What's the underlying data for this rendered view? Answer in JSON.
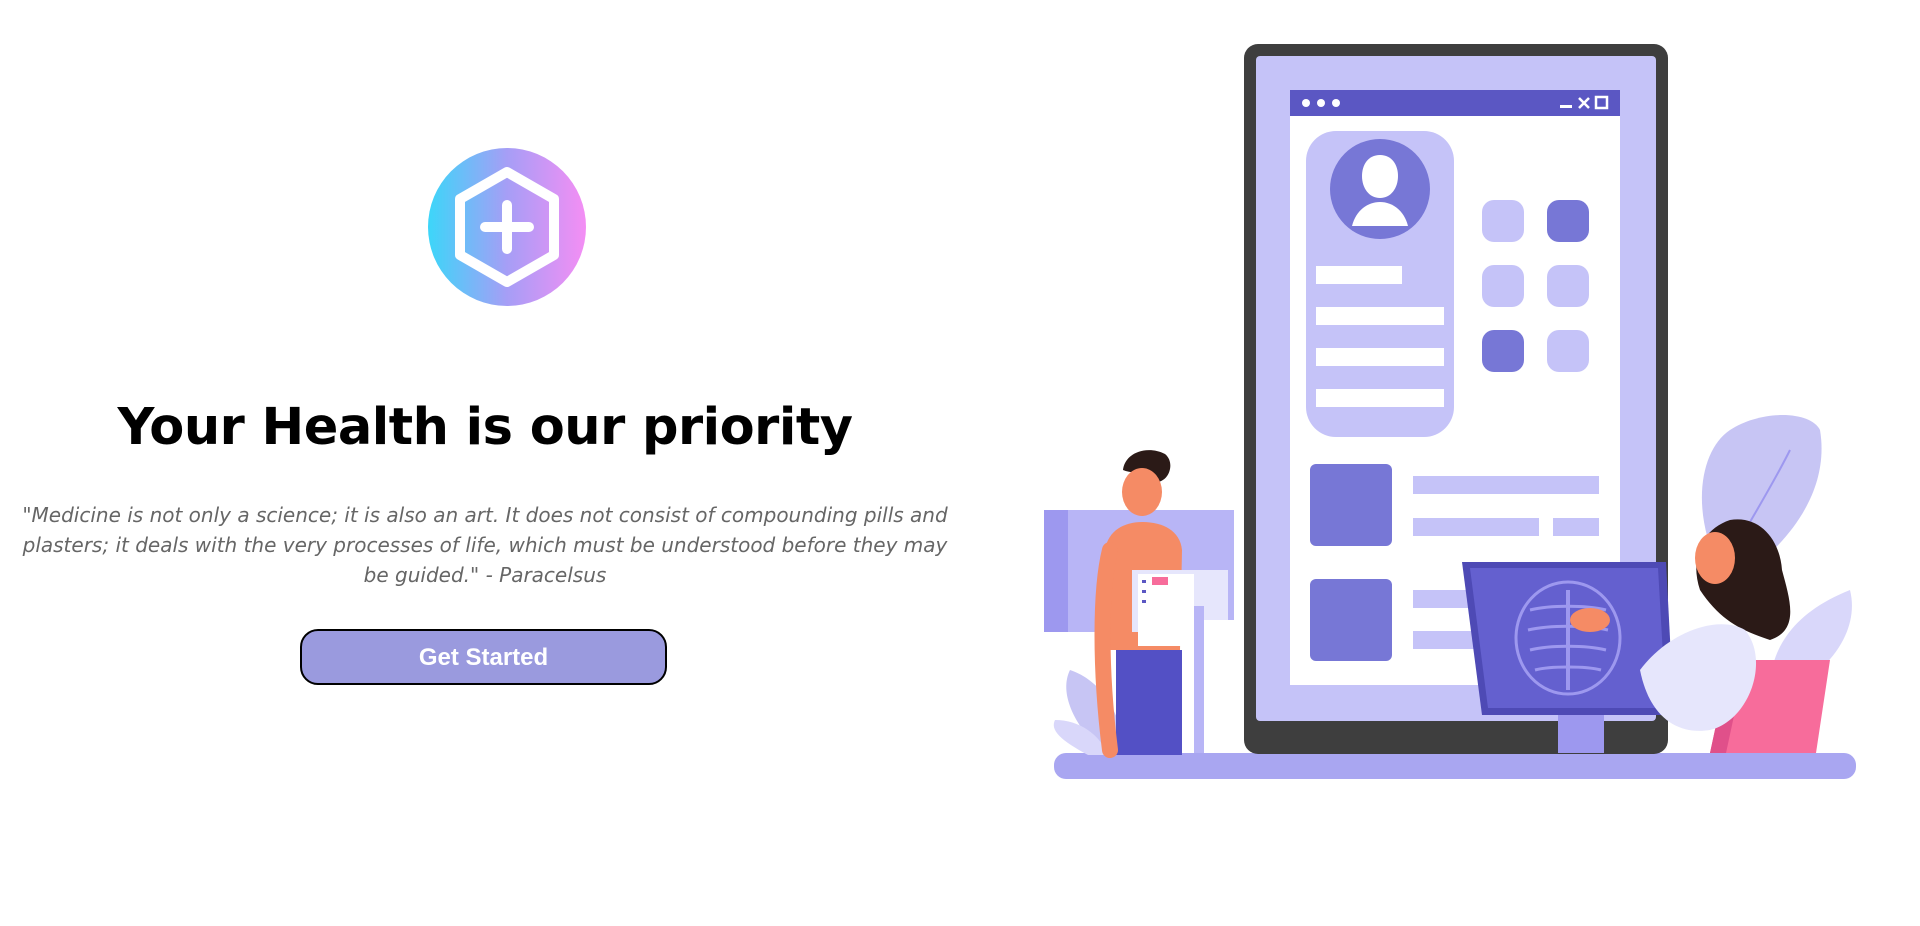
{
  "hero": {
    "logo_icon": "hexagon-plus-icon",
    "headline": "Your Health is our priority",
    "quote": "\"Medicine is not only a science; it is also an art. It does not consist of compounding pills and plasters; it deals with the very processes of life, which must be understood before they may be guided.\" - Paracelsus",
    "cta_label": "Get Started"
  },
  "illustration": {
    "subject": "doctor-patient-telehealth-illustration"
  },
  "colors": {
    "accent": "#9a9ade",
    "primary_purple": "#7777d6",
    "light_purple": "#c5c3f8",
    "pink": "#f76c9b",
    "dark": "#3e3e3e"
  }
}
